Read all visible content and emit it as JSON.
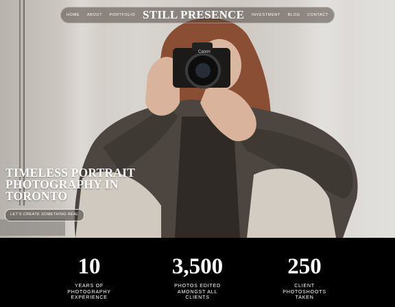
{
  "nav": {
    "home": "HOME",
    "about": "ABOUT",
    "portfolio": "PORTFOLIO",
    "logo": "STILL PRESENCE",
    "investment": "INVESTMENT",
    "blog": "BLOG",
    "contact": "CONTACT"
  },
  "hero": {
    "headline_line1": "TIMELESS PORTRAIT",
    "headline_line2": "PHOTOGRAPHY IN",
    "headline_line3": "TORONTO",
    "cta_label": "LET'S CREATE SOMETHING REAL",
    "camera_brand": "Canon"
  },
  "stats": [
    {
      "value": "10",
      "line1": "YEARS OF",
      "line2": "PHOTOGRAPHY",
      "line3": "EXPERIENCE"
    },
    {
      "value": "3,500",
      "line1": "PHOTOS EDITED",
      "line2": "AMONGST ALL",
      "line3": "CLIENTS"
    },
    {
      "value": "250",
      "line1": "CLIENT",
      "line2": "PHOTOSHOOTS",
      "line3": "TAKEN"
    }
  ],
  "colors": {
    "stats_background": "#000000",
    "text": "#ffffff",
    "nav_background": "#50463e"
  }
}
